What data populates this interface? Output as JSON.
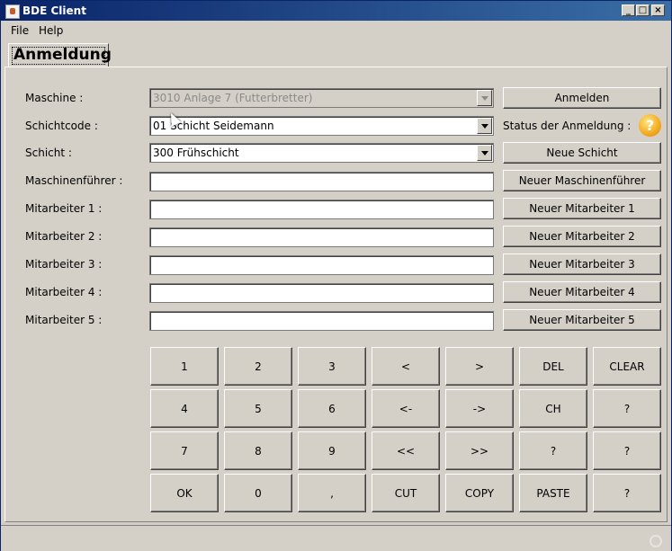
{
  "window": {
    "title": "BDE Client"
  },
  "menu": [
    "File",
    "Help"
  ],
  "tab": {
    "label": "Anmeldung"
  },
  "form": {
    "maschine": {
      "label": "Maschine :",
      "value": "3010 Anlage 7 (Futterbretter)"
    },
    "schichtcode": {
      "label": "Schichtcode :",
      "value": "01 Schicht Seidemann"
    },
    "schicht": {
      "label": "Schicht :",
      "value": "300 Frühschicht"
    },
    "maschinenfuehrer": {
      "label": "Maschinenführer :",
      "value": ""
    },
    "mitarbeiter": [
      {
        "label": "Mitarbeiter 1 :",
        "value": ""
      },
      {
        "label": "Mitarbeiter 2 :",
        "value": ""
      },
      {
        "label": "Mitarbeiter 3 :",
        "value": ""
      },
      {
        "label": "Mitarbeiter 4 :",
        "value": ""
      },
      {
        "label": "Mitarbeiter 5 :",
        "value": ""
      }
    ]
  },
  "side": {
    "anmelden": "Anmelden",
    "status_label": "Status der Anmeldung :",
    "status_icon": "?",
    "neue_schicht": "Neue Schicht",
    "neuer_maschinenfuehrer": "Neuer Maschinenführer",
    "neuer_mitarbeiter": [
      "Neuer Mitarbeiter 1",
      "Neuer Mitarbeiter 2",
      "Neuer Mitarbeiter 3",
      "Neuer Mitarbeiter 4",
      "Neuer Mitarbeiter 5"
    ]
  },
  "keypad": [
    [
      "1",
      "2",
      "3",
      "<",
      ">",
      "DEL",
      "CLEAR"
    ],
    [
      "4",
      "5",
      "6",
      "<-",
      "->",
      "CH",
      "?"
    ],
    [
      "7",
      "8",
      "9",
      "<<",
      ">>",
      "?",
      "?"
    ],
    [
      "OK",
      "0",
      ",",
      "CUT",
      "COPY",
      "PASTE",
      "?"
    ]
  ]
}
